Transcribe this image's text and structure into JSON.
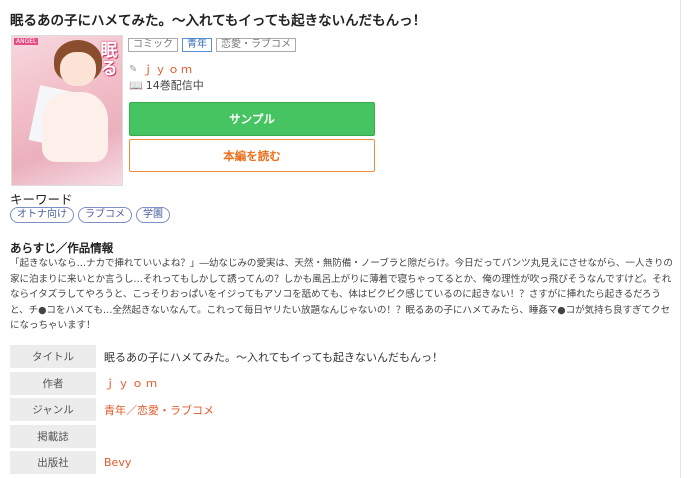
{
  "title": "眠るあの子にハメてみた。～入れてもイっても起きないんだもんっ！",
  "cover": {
    "alt_title": "眠るあの子にハメてみた",
    "logo_text": "ANGEL"
  },
  "tags": [
    "コミック",
    "青年",
    "恋愛・ラブコメ"
  ],
  "author": "ｊｙｏｍ",
  "volumes": "14巻配信中",
  "buttons": {
    "sample": "サンプル",
    "read": "本編を読む"
  },
  "keywords": {
    "heading": "キーワード",
    "items": [
      "オトナ向け",
      "ラブコメ",
      "学園"
    ]
  },
  "synopsis": {
    "heading": "あらすじ／作品情報",
    "text": "「起きないなら…ナカで挿れていいよね？」―幼なじみの愛実は、天然・無防備・ノーブラと隙だらけ。今日だってパンツ丸見えにさせながら、一人きりの家に泊まりに来いとか言うし…それってもしかして誘ってんの？しかも風呂上がりに薄着で寝ちゃってるとか、俺の理性が吹っ飛びそうなんですけど。それならイタズラしてやろうと、こっそりおっぱいをイジってもアソコを舐めても、体はビクビク感じているのに起きない！？さすがに挿れたら起きるだろうと、チ●コをハメても…全然起きないなんて。これって毎日ヤリたい放題なんじゃないの！？眠るあの子にハメてみたら、睡姦マ●コが気持ち良すぎてクセになっちゃいます！"
  },
  "info": {
    "title_label": "タイトル",
    "title_value": "眠るあの子にハメてみた。～入れてもイっても起きないんだもんっ！",
    "author_label": "作者",
    "author_value": "ｊｙｏｍ",
    "genre_label": "ジャンル",
    "genre_value": "青年／恋愛・ラブコメ",
    "magazine_label": "掲載誌",
    "magazine_value": "",
    "publisher_label": "出版社",
    "publisher_value": "Bevy"
  },
  "colors": {
    "accent": "#e0582a",
    "sample_button": "#46c462",
    "read_border": "#f08c3a",
    "keyword_border": "#7b8fc4"
  }
}
